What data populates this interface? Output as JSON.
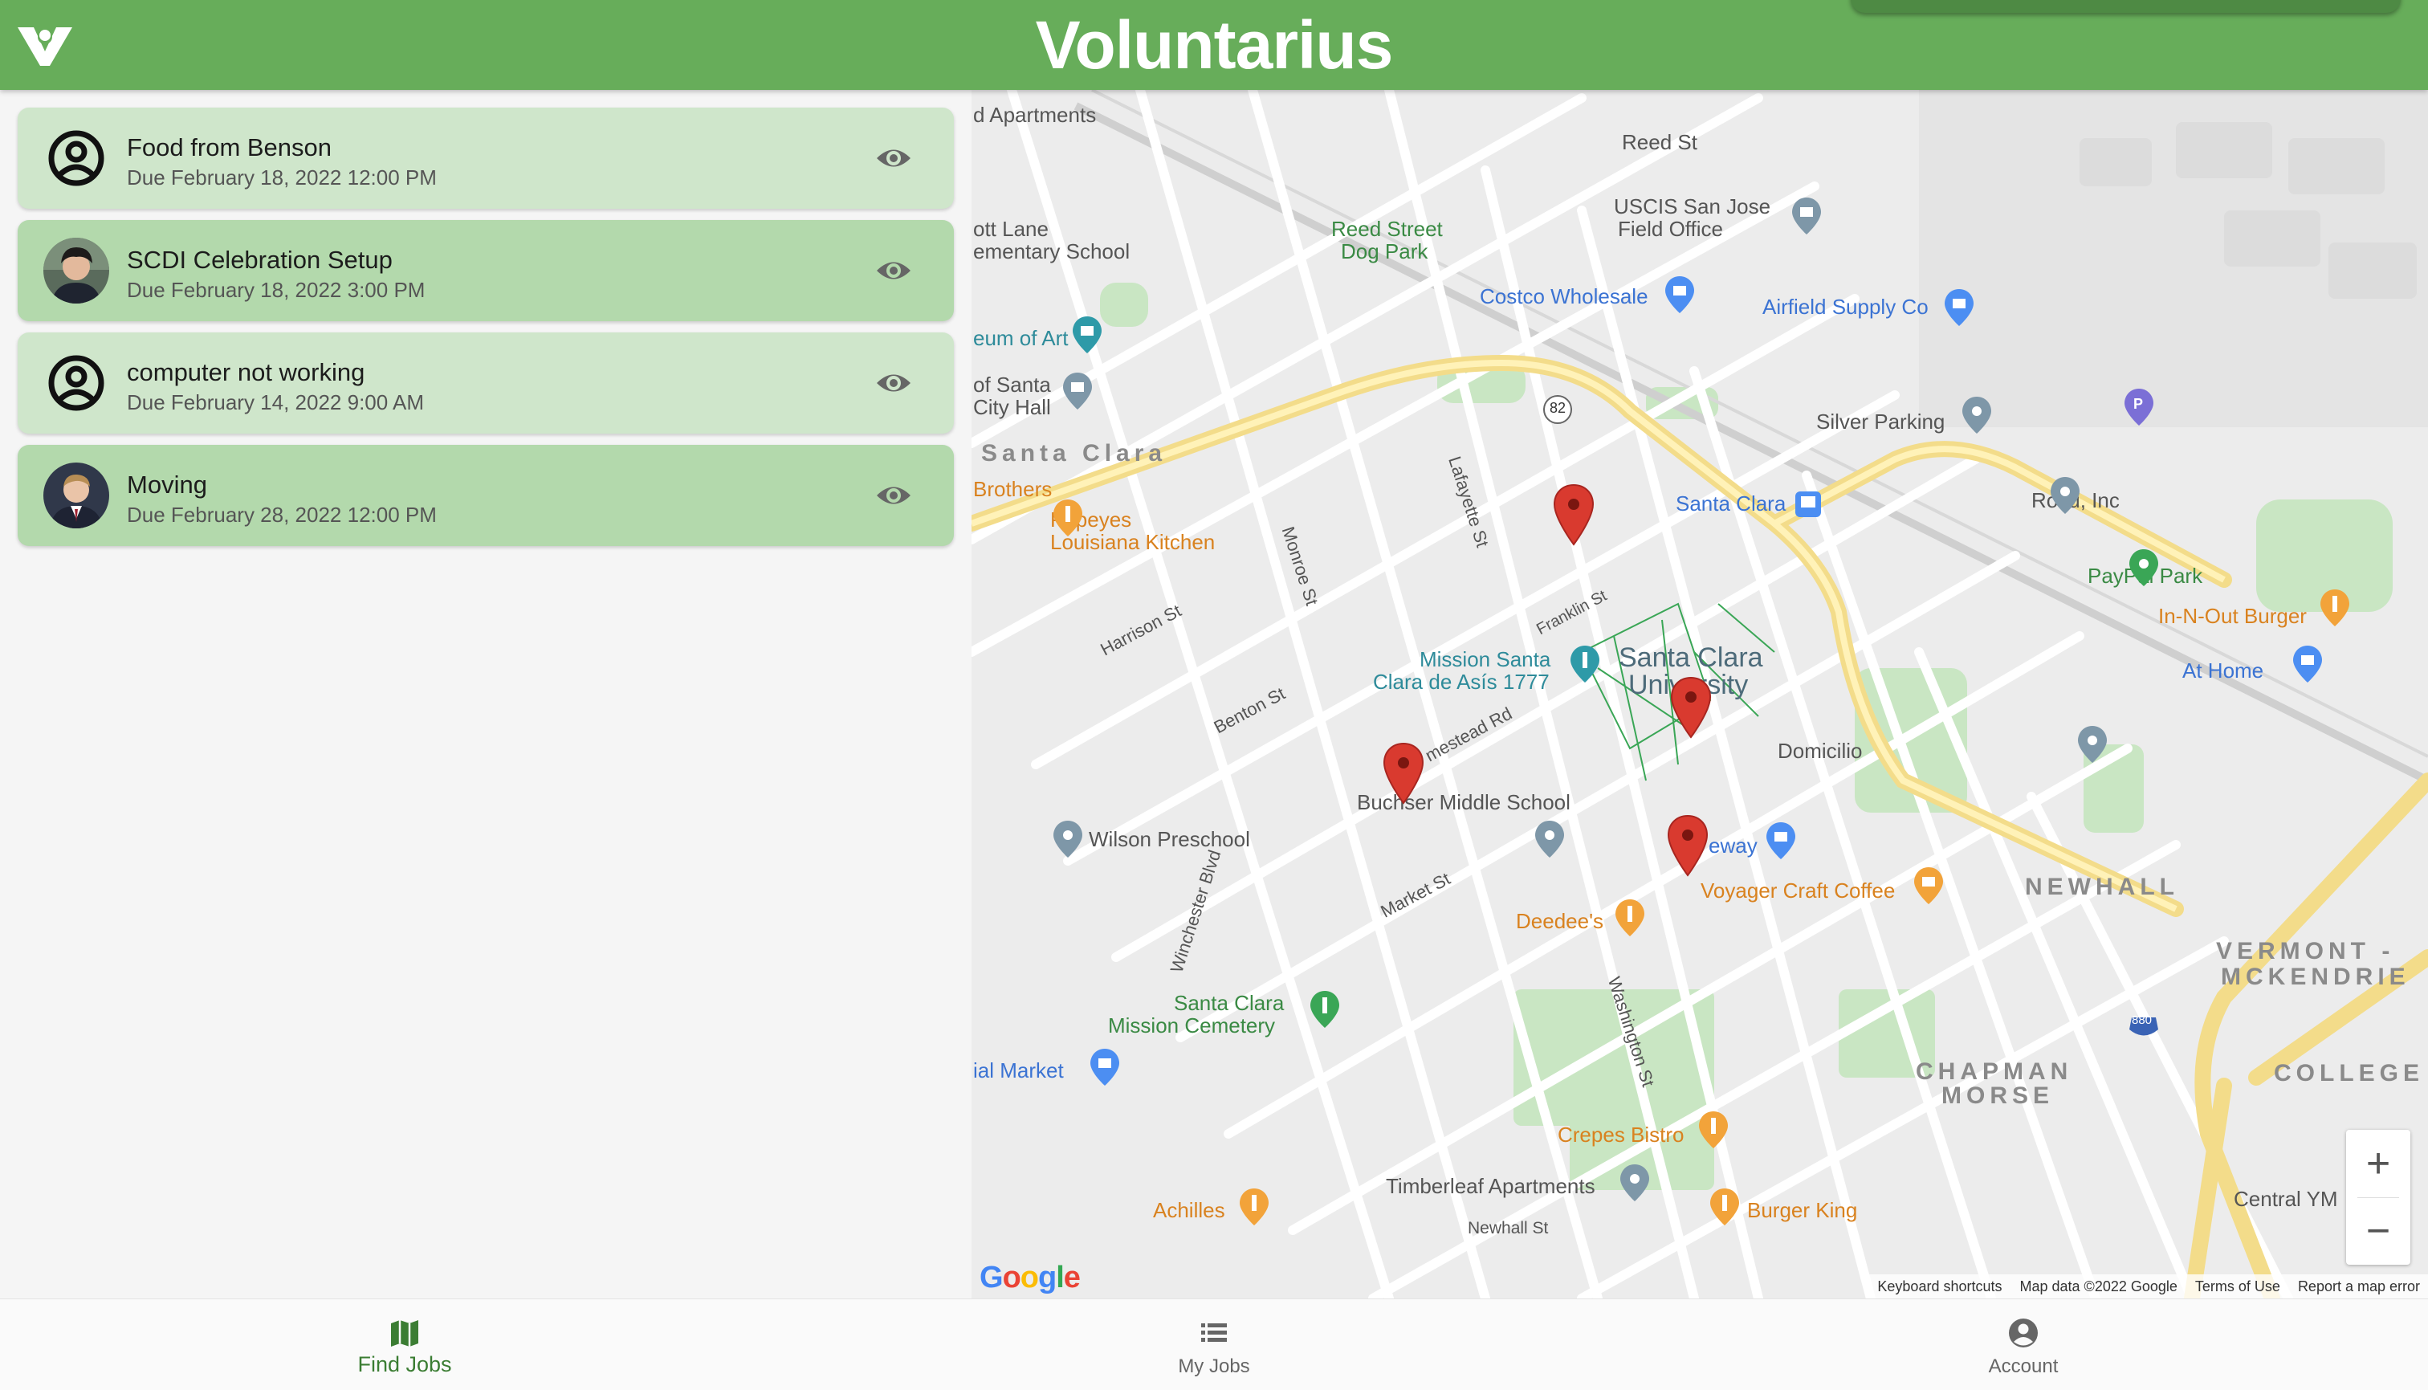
{
  "app": {
    "title": "Voluntarius"
  },
  "jobs": [
    {
      "title": "Food from Benson",
      "due": "Due February 18, 2022 12:00 PM",
      "avatar": "person-outline"
    },
    {
      "title": "SCDI Celebration Setup",
      "due": "Due February 18, 2022 3:00 PM",
      "avatar": "photo"
    },
    {
      "title": "computer not working",
      "due": "Due February 14, 2022 9:00 AM",
      "avatar": "person-outline"
    },
    {
      "title": "Moving",
      "due": "Due February 28, 2022 12:00 PM",
      "avatar": "photo"
    }
  ],
  "map": {
    "labels": {
      "apartments": "d Apartments",
      "reed_st": "Reed St",
      "uscis": "USCIS San Jose Field Office",
      "uscis_1": "USCIS San Jose",
      "uscis_2": "Field Office",
      "elementary_1": "ott Lane",
      "elementary_2": "ementary School",
      "dog_park_1": "Reed Street",
      "dog_park_2": "Dog Park",
      "costco": "Costco Wholesale",
      "airfield": "Airfield Supply Co",
      "museum": "eum of Art",
      "city_hall_1": "of Santa",
      "city_hall_2": "City Hall",
      "silver_parking": "Silver Parking",
      "santa_clara_district": "Santa Clara",
      "brothers": "Brothers",
      "popeyes_1": "Popeyes",
      "popeyes_2": "Louisiana Kitchen",
      "santa_clara_station": "Santa Clara",
      "roku": "Roku, Inc",
      "paypal_park": "PayPal Park",
      "in_n_out": "In-N-Out Burger",
      "at_home": "At Home",
      "mission_1": "Mission Santa",
      "mission_2": "Clara de Asís 1777",
      "scu_1": "Santa Clara",
      "scu_2": "University",
      "domicilio": "Domicilio",
      "buchser": "Buchser Middle School",
      "wilson": "Wilson Preschool",
      "safeway": "eway",
      "voyager": "Voyager Craft Coffee",
      "newhall_district": "NEWHALL",
      "deedees": "Deedee's",
      "vermont": "VERMONT -",
      "mckendrie": "MCKENDRIE",
      "cemetery_1": "Santa Clara",
      "cemetery_2": "Mission Cemetery",
      "market": "ial Market",
      "chapman": "CHAPMAN",
      "morse": "MORSE",
      "college": "COLLEGE",
      "crepes": "Crepes Bistro",
      "timberleaf": "Timberleaf Apartments",
      "achilles": "Achilles",
      "burger_king": "Burger King",
      "newhall_st": "Newhall St",
      "central": "Central YM",
      "monroe": "Monroe St",
      "lafayette": "Lafayette St",
      "harrison": "Harrison St",
      "benton": "Benton St",
      "market_st": "Market St",
      "washington": "Washington St",
      "homestead": "mestead Rd",
      "franklin": "Franklin St",
      "winchester": "Winchester Blvd",
      "hw82": "82",
      "i880": "880"
    },
    "attribution": {
      "keyboard": "Keyboard shortcuts",
      "data": "Map data ©2022 Google",
      "terms": "Terms of Use",
      "report": "Report a map error"
    },
    "google_logo": "Google",
    "zoom_in": "+",
    "zoom_out": "−"
  },
  "nav": [
    {
      "label": "Find Jobs",
      "icon": "map-icon",
      "active": true
    },
    {
      "label": "My Jobs",
      "icon": "list-icon",
      "active": false
    },
    {
      "label": "Account",
      "icon": "account-circle-icon",
      "active": false
    }
  ],
  "colors": {
    "header": "#67ad5a",
    "card_light": "#cfe6cb",
    "card_dark": "#b3d9ac",
    "pin": "#d93a2f",
    "nav_active": "#3b7d33"
  }
}
